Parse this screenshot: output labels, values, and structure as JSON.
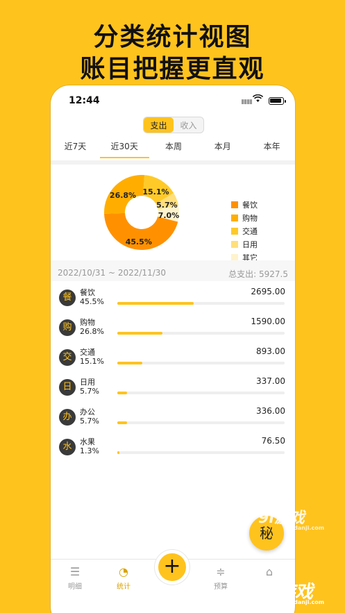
{
  "headline": {
    "line1": "分类统计视图",
    "line2": "账目把握更直观"
  },
  "status": {
    "time": "12:44"
  },
  "type_toggle": {
    "expense": "支出",
    "income": "收入"
  },
  "ranges": [
    "近7天",
    "近30天",
    "本周",
    "本月",
    "本年"
  ],
  "chart_data": {
    "type": "pie",
    "style": "donut",
    "categories": [
      "餐饮",
      "购物",
      "交通",
      "日用",
      "其它"
    ],
    "values": [
      45.5,
      26.8,
      15.1,
      5.7,
      7.0
    ],
    "labels": [
      "45.5%",
      "26.8%",
      "15.1%",
      "5.7%",
      "7.0%"
    ],
    "colors": [
      "#FF9100",
      "#FFAE00",
      "#FFCA28",
      "#FFDF7A",
      "#FFF3CC"
    ],
    "legend": [
      "餐饮",
      "购物",
      "交通",
      "日用",
      "其它"
    ],
    "legend_position": "right"
  },
  "summary": {
    "date_range": "2022/10/31 ~ 2022/11/30",
    "total": "总支出:  5927.5"
  },
  "rows": [
    {
      "icon": "餐",
      "name": "餐饮",
      "pct": "45.5%",
      "amount": "2695.00",
      "fraction": 0.455
    },
    {
      "icon": "购",
      "name": "购物",
      "pct": "26.8%",
      "amount": "1590.00",
      "fraction": 0.268
    },
    {
      "icon": "交",
      "name": "交通",
      "pct": "15.1%",
      "amount": "893.00",
      "fraction": 0.151
    },
    {
      "icon": "日",
      "name": "日用",
      "pct": "5.7%",
      "amount": "337.00",
      "fraction": 0.057
    },
    {
      "icon": "办",
      "name": "办公",
      "pct": "5.7%",
      "amount": "336.00",
      "fraction": 0.057
    },
    {
      "icon": "水",
      "name": "水果",
      "pct": "1.3%",
      "amount": "76.50",
      "fraction": 0.013
    }
  ],
  "secret_button": "秘",
  "tabs": {
    "details": "明细",
    "stats": "统计",
    "add": "+",
    "budget": "预算",
    "home": ""
  },
  "watermark": {
    "brand": "9l游戏",
    "site": "91danji.com"
  },
  "accent": "#FFC31E"
}
